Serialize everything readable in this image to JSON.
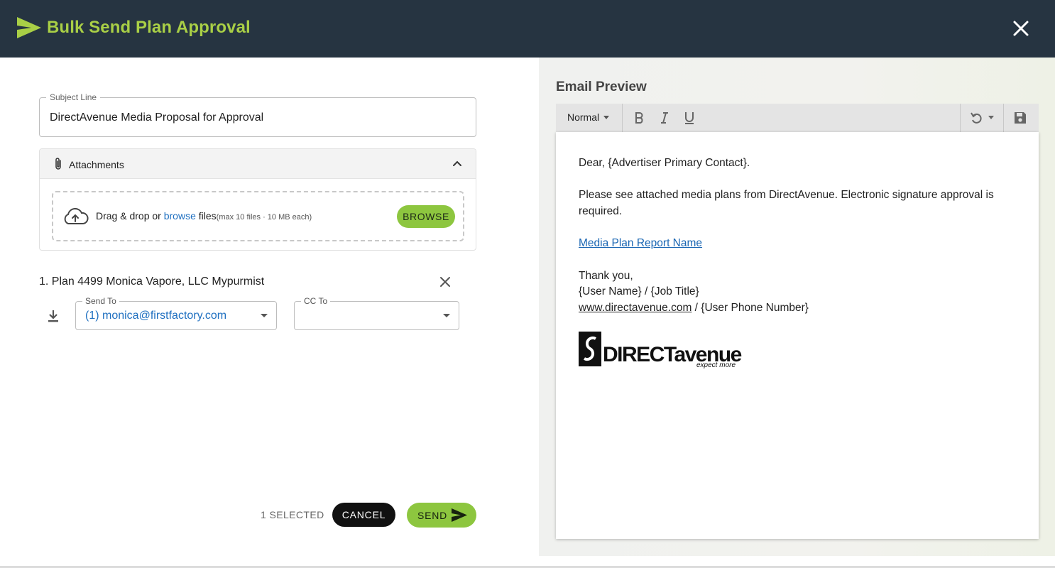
{
  "header": {
    "title": "Bulk Send Plan Approval",
    "brand_color": "#a9cf46",
    "bg_color": "#263441"
  },
  "subject": {
    "label": "Subject Line",
    "value": "DirectAvenue Media Proposal for Approval"
  },
  "attachments": {
    "title": "Attachments",
    "drop_prefix": "Drag & drop or",
    "drop_link": "browse",
    "drop_suffix": "files",
    "drop_note": "(max 10 files · 10 MB each)",
    "browse_label": "BROWSE"
  },
  "plan": {
    "title": "1. Plan 4499 Monica Vapore, LLC Mypurmist",
    "send_to_label": "Send To",
    "send_to_value": "(1) monica@firstfactory.com",
    "cc_to_label": "CC To",
    "cc_to_value": ""
  },
  "footer": {
    "selected_text": "1 SELECTED",
    "cancel_label": "CANCEL",
    "send_label": "SEND"
  },
  "preview": {
    "title": "Email Preview",
    "toolbar": {
      "style_value": "Normal",
      "icons": [
        "bold-icon",
        "italic-icon",
        "underline-icon",
        "undo-icon",
        "save-icon"
      ]
    },
    "email": {
      "greeting": "Dear, {Advertiser Primary Contact}.",
      "body_line1": "Please see attached media plans from DirectAvenue. Electronic signature approval is",
      "body_line2": "required.",
      "report_link": "Media Plan Report Name",
      "signoff": "Thank you,",
      "user_line": "{User Name} / {Job Title}",
      "website": "www.directavenue.com",
      "phone_suffix": " / {User Phone Number}",
      "logo_text": "DIRECTavenue",
      "logo_tagline": "expect more"
    }
  },
  "colors": {
    "accent_green": "#8dc63f",
    "link_blue": "#1e6fc0"
  }
}
